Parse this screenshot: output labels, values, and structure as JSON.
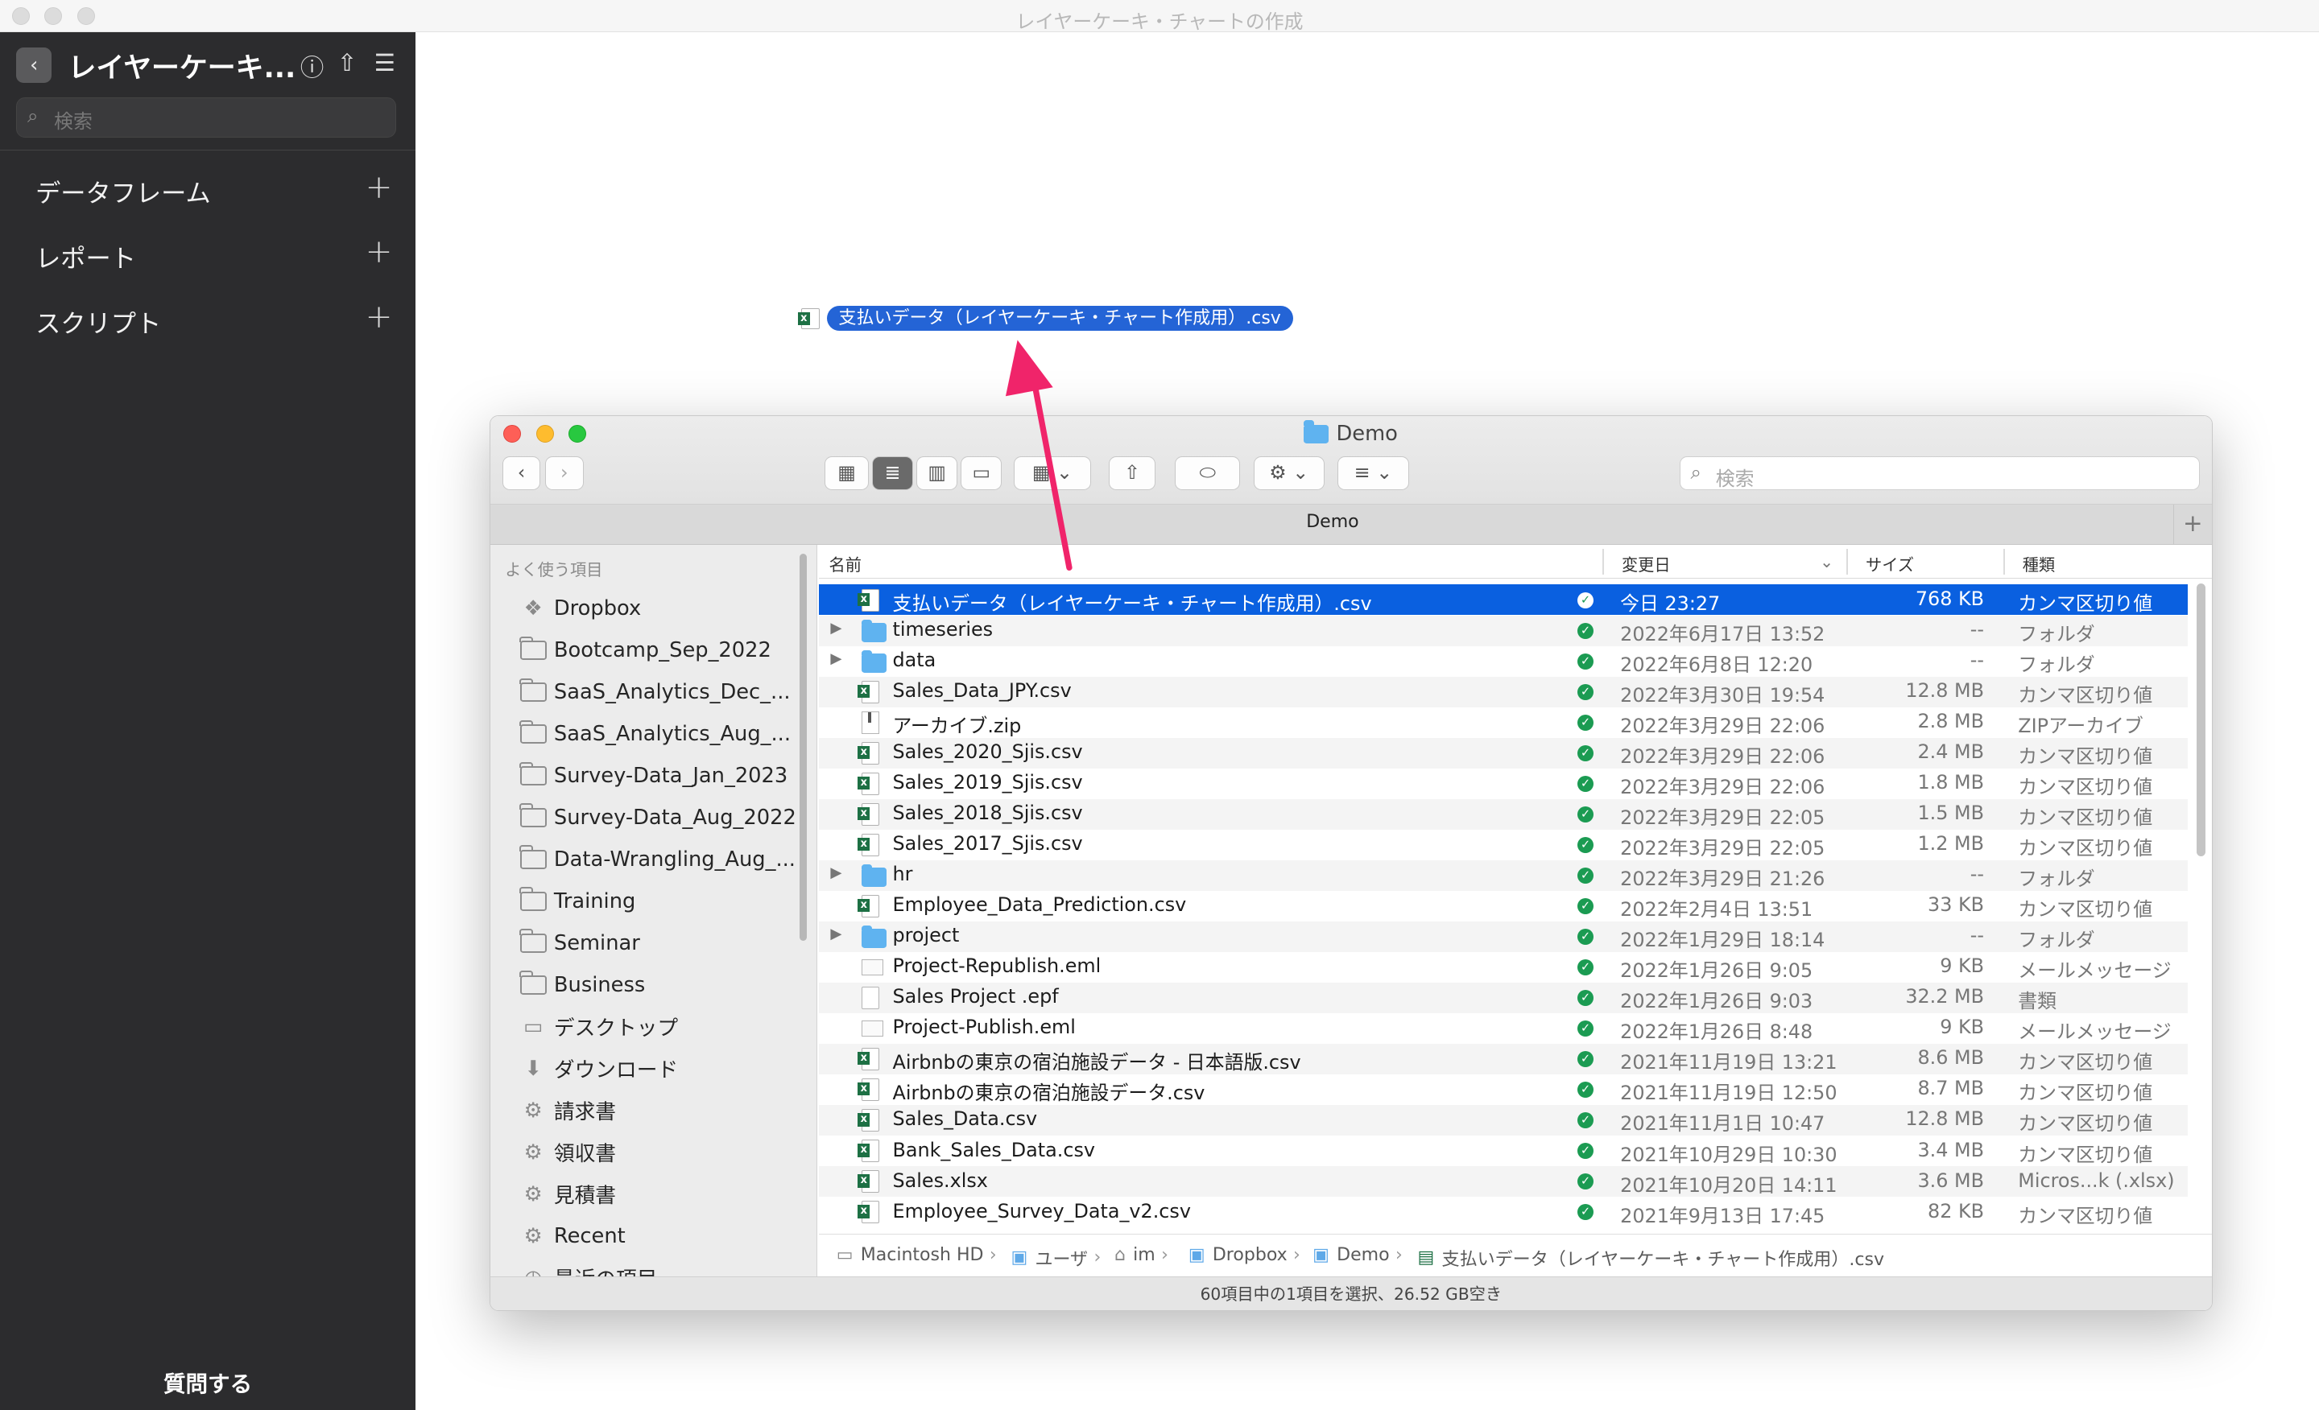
{
  "app": {
    "window_title": "レイヤーケーキ・チャートの作成"
  },
  "sidebar": {
    "title": "レイヤーケーキ...",
    "search_placeholder": "検索",
    "sections": [
      {
        "label": "データフレーム"
      },
      {
        "label": "レポート"
      },
      {
        "label": "スクリプト"
      }
    ],
    "ask_label": "質問する"
  },
  "dragged_file": {
    "name": "支払いデータ（レイヤーケーキ・チャート作成用）.csv"
  },
  "finder": {
    "title": "Demo",
    "tab_title": "Demo",
    "search_placeholder": "検索",
    "sidebar_header": "よく使う項目",
    "favorites": [
      {
        "label": "Dropbox",
        "icon": "dropbox-icon"
      },
      {
        "label": "Bootcamp_Sep_2022",
        "icon": "folder-icon"
      },
      {
        "label": "SaaS_Analytics_Dec_...",
        "icon": "folder-icon"
      },
      {
        "label": "SaaS_Analytics_Aug_...",
        "icon": "folder-icon"
      },
      {
        "label": "Survey-Data_Jan_2023",
        "icon": "folder-icon"
      },
      {
        "label": "Survey-Data_Aug_2022",
        "icon": "folder-icon"
      },
      {
        "label": "Data-Wrangling_Aug_...",
        "icon": "folder-icon"
      },
      {
        "label": "Training",
        "icon": "folder-icon"
      },
      {
        "label": "Seminar",
        "icon": "folder-icon"
      },
      {
        "label": "Business",
        "icon": "folder-icon"
      },
      {
        "label": "デスクトップ",
        "icon": "desktop-icon"
      },
      {
        "label": "ダウンロード",
        "icon": "download-icon"
      },
      {
        "label": "請求書",
        "icon": "gear-icon"
      },
      {
        "label": "領収書",
        "icon": "gear-icon"
      },
      {
        "label": "見積書",
        "icon": "gear-icon"
      },
      {
        "label": "Recent",
        "icon": "gear-icon"
      },
      {
        "label": "最近の項目",
        "icon": "clock-icon"
      }
    ],
    "columns": {
      "name": "名前",
      "date": "変更日",
      "size": "サイズ",
      "kind": "種類"
    },
    "files": [
      {
        "name": "支払いデータ（レイヤーケーキ・チャート作成用）.csv",
        "date": "今日 23:27",
        "size": "768 KB",
        "kind": "カンマ区切り値",
        "icon": "csv",
        "folder": false
      },
      {
        "name": "timeseries",
        "date": "2022年6月17日 13:52",
        "size": "--",
        "kind": "フォルダ",
        "icon": "folder",
        "folder": true
      },
      {
        "name": "data",
        "date": "2022年6月8日 12:20",
        "size": "--",
        "kind": "フォルダ",
        "icon": "folder",
        "folder": true
      },
      {
        "name": "Sales_Data_JPY.csv",
        "date": "2022年3月30日 19:54",
        "size": "12.8 MB",
        "kind": "カンマ区切り値",
        "icon": "csv",
        "folder": false
      },
      {
        "name": "アーカイブ.zip",
        "date": "2022年3月29日 22:06",
        "size": "2.8 MB",
        "kind": "ZIPアーカイブ",
        "icon": "zip",
        "folder": false
      },
      {
        "name": "Sales_2020_Sjis.csv",
        "date": "2022年3月29日 22:06",
        "size": "2.4 MB",
        "kind": "カンマ区切り値",
        "icon": "csv",
        "folder": false
      },
      {
        "name": "Sales_2019_Sjis.csv",
        "date": "2022年3月29日 22:06",
        "size": "1.8 MB",
        "kind": "カンマ区切り値",
        "icon": "csv",
        "folder": false
      },
      {
        "name": "Sales_2018_Sjis.csv",
        "date": "2022年3月29日 22:05",
        "size": "1.5 MB",
        "kind": "カンマ区切り値",
        "icon": "csv",
        "folder": false
      },
      {
        "name": "Sales_2017_Sjis.csv",
        "date": "2022年3月29日 22:05",
        "size": "1.2 MB",
        "kind": "カンマ区切り値",
        "icon": "csv",
        "folder": false
      },
      {
        "name": "hr",
        "date": "2022年3月29日 21:26",
        "size": "--",
        "kind": "フォルダ",
        "icon": "folder",
        "folder": true
      },
      {
        "name": "Employee_Data_Prediction.csv",
        "date": "2022年2月4日 13:51",
        "size": "33 KB",
        "kind": "カンマ区切り値",
        "icon": "csv",
        "folder": false
      },
      {
        "name": "project",
        "date": "2022年1月29日 18:14",
        "size": "--",
        "kind": "フォルダ",
        "icon": "folder",
        "folder": true
      },
      {
        "name": "Project-Republish.eml",
        "date": "2022年1月26日 9:05",
        "size": "9 KB",
        "kind": "メールメッセージ",
        "icon": "mail",
        "folder": false
      },
      {
        "name": "Sales Project .epf",
        "date": "2022年1月26日 9:03",
        "size": "32.2 MB",
        "kind": "書類",
        "icon": "doc",
        "folder": false
      },
      {
        "name": "Project-Publish.eml",
        "date": "2022年1月26日 8:48",
        "size": "9 KB",
        "kind": "メールメッセージ",
        "icon": "mail",
        "folder": false
      },
      {
        "name": "Airbnbの東京の宿泊施設データ - 日本語版.csv",
        "date": "2021年11月19日 13:21",
        "size": "8.6 MB",
        "kind": "カンマ区切り値",
        "icon": "csv",
        "folder": false
      },
      {
        "name": "Airbnbの東京の宿泊施設データ.csv",
        "date": "2021年11月19日 12:50",
        "size": "8.7 MB",
        "kind": "カンマ区切り値",
        "icon": "csv",
        "folder": false
      },
      {
        "name": "Sales_Data.csv",
        "date": "2021年11月1日 10:47",
        "size": "12.8 MB",
        "kind": "カンマ区切り値",
        "icon": "csv",
        "folder": false
      },
      {
        "name": "Bank_Sales_Data.csv",
        "date": "2021年10月29日 10:30",
        "size": "3.4 MB",
        "kind": "カンマ区切り値",
        "icon": "csv",
        "folder": false
      },
      {
        "name": "Sales.xlsx",
        "date": "2021年10月20日 14:11",
        "size": "3.6 MB",
        "kind": "Micros...k (.xlsx)",
        "icon": "xlsx",
        "folder": false
      },
      {
        "name": "Employee_Survey_Data_v2.csv",
        "date": "2021年9月13日 17:45",
        "size": "82 KB",
        "kind": "カンマ区切り値",
        "icon": "csv",
        "folder": false
      }
    ],
    "path": [
      "Macintosh HD",
      "ユーザ",
      "im",
      "Dropbox",
      "Demo",
      "支払いデータ（レイヤーケーキ・チャート作成用）.csv"
    ],
    "status": "60項目中の1項目を選択、26.52 GB空き"
  }
}
